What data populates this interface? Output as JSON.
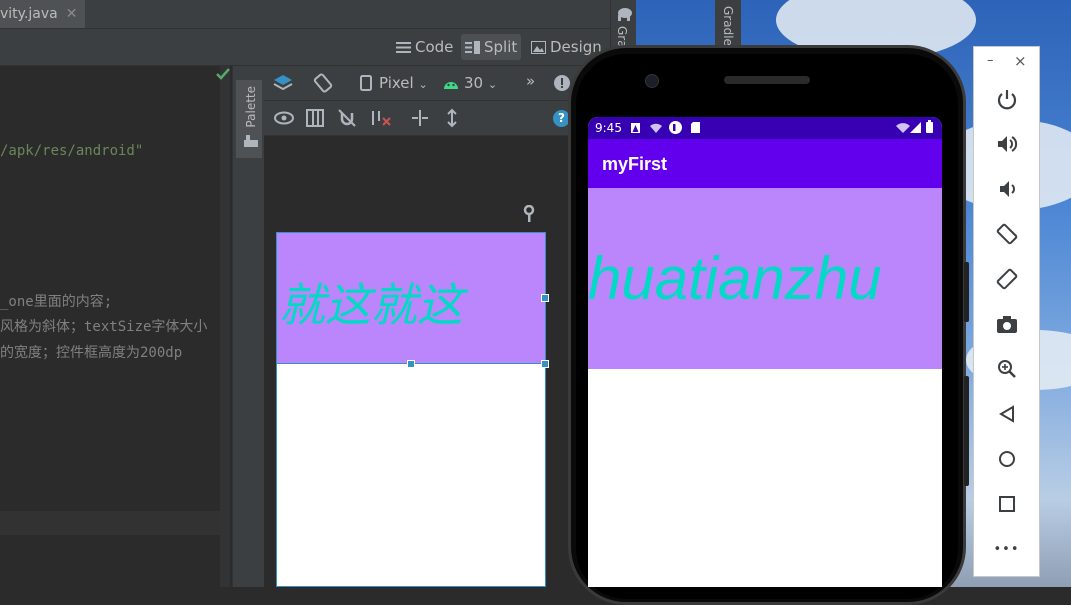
{
  "ide": {
    "file_tab": {
      "label": "vity.java",
      "close": "✕"
    },
    "view_modes": [
      {
        "label": "Code",
        "icon": "code-lines-icon"
      },
      {
        "label": "Split",
        "icon": "split-icon",
        "active": true
      },
      {
        "label": "Design",
        "icon": "image-icon"
      }
    ],
    "editor_lines": [
      {
        "text": "/apk/res/android\"",
        "kind": "str"
      },
      {
        "text": "_one里面的内容;",
        "kind": "cmt"
      },
      {
        "text": "风格为斜体；textSize字体大小",
        "kind": "cmt"
      },
      {
        "text": "的宽度；控件框高度为200dp",
        "kind": "cmt"
      }
    ],
    "palette_label": "Palette",
    "gradle_label": "Gradle",
    "toolbar": {
      "device": "Pixel",
      "api_level": "30",
      "overflow": "»",
      "help": "?"
    },
    "preview_text": "就这就这"
  },
  "emulator": {
    "status_time": "9:45",
    "app_title": "myFirst",
    "text_content": "huatianzhu",
    "window_controls": {
      "minimize": "–",
      "close": "×"
    },
    "side_controls": [
      {
        "name": "power-icon"
      },
      {
        "name": "volume-up-icon"
      },
      {
        "name": "volume-down-icon"
      },
      {
        "name": "rotate-left-icon"
      },
      {
        "name": "rotate-right-icon"
      },
      {
        "name": "camera-icon"
      },
      {
        "name": "zoom-icon"
      },
      {
        "name": "back-icon"
      },
      {
        "name": "home-icon"
      },
      {
        "name": "overview-icon"
      },
      {
        "name": "more-icon",
        "glyph": "•••"
      }
    ]
  },
  "colors": {
    "primary": "#6200ee",
    "primary_dark": "#3700b3",
    "textview_bg": "#bb86fc",
    "text_color": "#03dac5",
    "selection_blue": "#3592c4"
  }
}
